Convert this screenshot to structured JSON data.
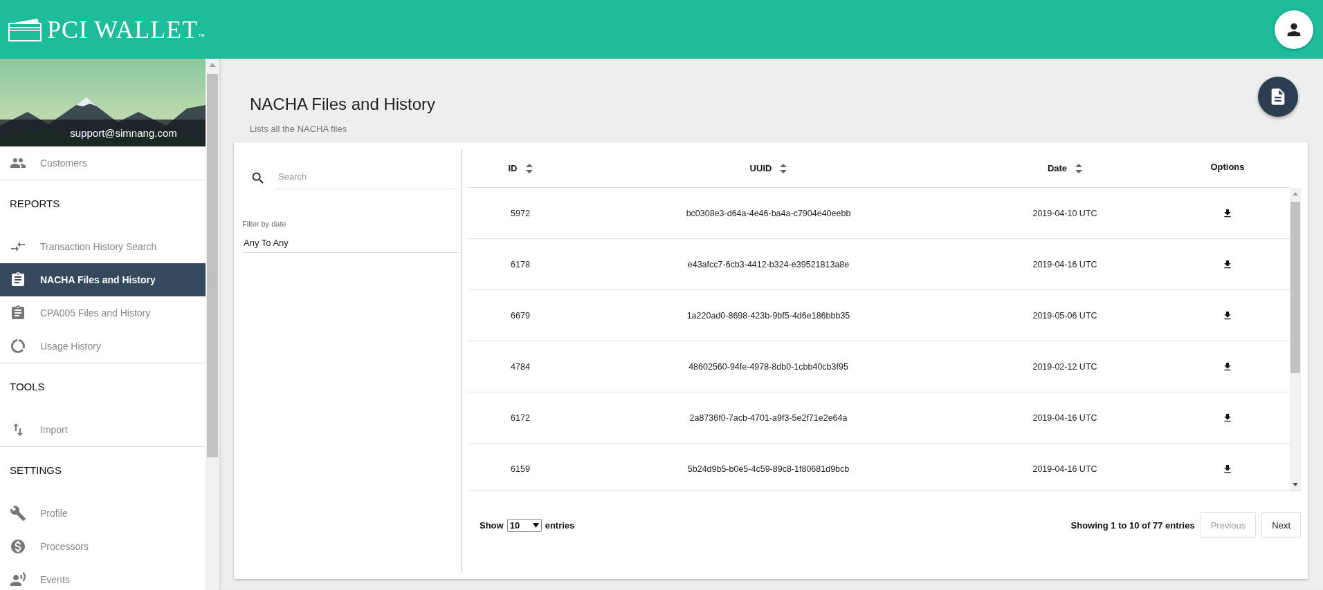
{
  "header": {
    "logo_text": "PCI WALLET",
    "trademark": "™"
  },
  "sidebar": {
    "user_email": "support@simnang.com",
    "sections": [
      {
        "items": [
          {
            "label": "Customers",
            "selected": false
          }
        ]
      },
      {
        "title": "REPORTS",
        "items": [
          {
            "label": "Transaction History Search",
            "selected": false
          },
          {
            "label": "NACHA Files and History",
            "selected": true
          },
          {
            "label": "CPA005 Files and History",
            "selected": false
          },
          {
            "label": "Usage History",
            "selected": false
          }
        ]
      },
      {
        "title": "TOOLS",
        "items": [
          {
            "label": "Import",
            "selected": false
          }
        ]
      },
      {
        "title": "SETTINGS",
        "items": [
          {
            "label": "Profile",
            "selected": false
          },
          {
            "label": "Processors",
            "selected": false
          },
          {
            "label": "Events",
            "selected": false
          }
        ]
      }
    ]
  },
  "page": {
    "title": "NACHA Files and History",
    "subtitle": "Lists all the NACHA files"
  },
  "filters": {
    "search_placeholder": "Search",
    "date_label": "Filter by date",
    "date_value": "Any To Any"
  },
  "table": {
    "columns": [
      {
        "label": "ID",
        "sortable": true
      },
      {
        "label": "UUID",
        "sortable": true
      },
      {
        "label": "Date",
        "sortable": true
      },
      {
        "label": "Options",
        "sortable": false
      }
    ],
    "rows": [
      {
        "id": "5972",
        "uuid": "bc0308e3-d64a-4e46-ba4a-c7904e40eebb",
        "date": "2019-04-10 UTC"
      },
      {
        "id": "6178",
        "uuid": "e43afcc7-6cb3-4412-b324-e39521813a8e",
        "date": "2019-04-16 UTC"
      },
      {
        "id": "6679",
        "uuid": "1a220ad0-8698-423b-9bf5-4d6e186bbb35",
        "date": "2019-05-06 UTC"
      },
      {
        "id": "4784",
        "uuid": "48602560-94fe-4978-8db0-1cbb40cb3f95",
        "date": "2019-02-12 UTC"
      },
      {
        "id": "6172",
        "uuid": "2a8736f0-7acb-4701-a9f3-5e2f71e2e64a",
        "date": "2019-04-16 UTC"
      },
      {
        "id": "6159",
        "uuid": "5b24d9b5-b0e5-4c59-89c8-1f80681d9bcb",
        "date": "2019-04-16 UTC"
      }
    ]
  },
  "footer": {
    "show_label": "Show",
    "page_size": "10",
    "entries_label": "entries",
    "summary": "Showing 1 to 10 of 77 entries",
    "buttons": [
      {
        "label": "Previous",
        "disabled": true
      },
      {
        "label": "Next",
        "disabled": false
      }
    ]
  }
}
